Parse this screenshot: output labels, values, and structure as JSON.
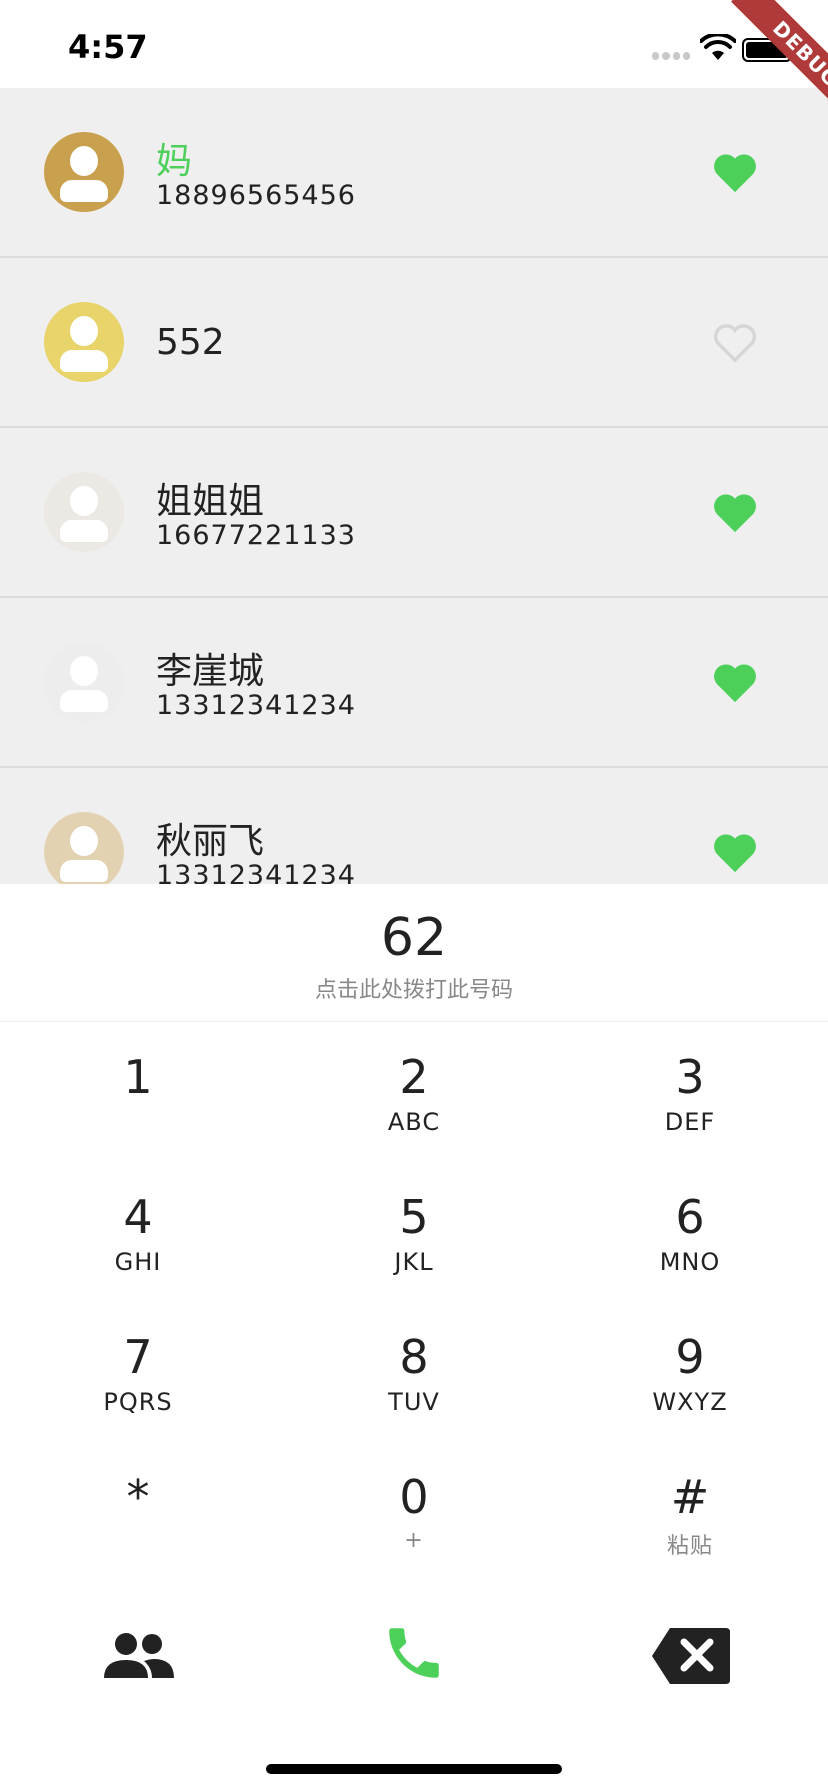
{
  "status_bar": {
    "time": "4:57"
  },
  "debug_banner": "DEBUG",
  "contacts": [
    {
      "name": "妈",
      "number": "18896565456",
      "avatar_color": "#c9a04e",
      "name_color": "#4cd05a",
      "favorite": true
    },
    {
      "name": "552",
      "number": "",
      "avatar_color": "#e8d46a",
      "favorite": false
    },
    {
      "name": "姐姐姐",
      "number": "16677221133",
      "avatar_color": "#ece9e4",
      "favorite": true
    },
    {
      "name": "李崖城",
      "number": "13312341234",
      "avatar_color": "#ededed",
      "favorite": true
    },
    {
      "name": "秋丽飞",
      "number": "13312341234",
      "avatar_color": "#e2d2b2",
      "favorite": true
    }
  ],
  "dialer": {
    "number": "62",
    "hint": "点击此处拨打此号码"
  },
  "keypad": [
    {
      "digit": "1",
      "letters": ""
    },
    {
      "digit": "2",
      "letters": "ABC"
    },
    {
      "digit": "3",
      "letters": "DEF"
    },
    {
      "digit": "4",
      "letters": "GHI"
    },
    {
      "digit": "5",
      "letters": "JKL"
    },
    {
      "digit": "6",
      "letters": "MNO"
    },
    {
      "digit": "7",
      "letters": "PQRS"
    },
    {
      "digit": "8",
      "letters": "TUV"
    },
    {
      "digit": "9",
      "letters": "WXYZ"
    },
    {
      "digit": "*",
      "letters": ""
    },
    {
      "digit": "0",
      "letters": "+"
    },
    {
      "digit": "#",
      "letters": "粘贴"
    }
  ],
  "actions": {
    "contacts_icon": "people-icon",
    "call_icon": "phone-icon",
    "backspace_icon": "backspace-icon"
  },
  "colors": {
    "accent_green": "#4cd05a",
    "list_background": "#efefef",
    "heart_inactive": "#d6d6d6"
  }
}
